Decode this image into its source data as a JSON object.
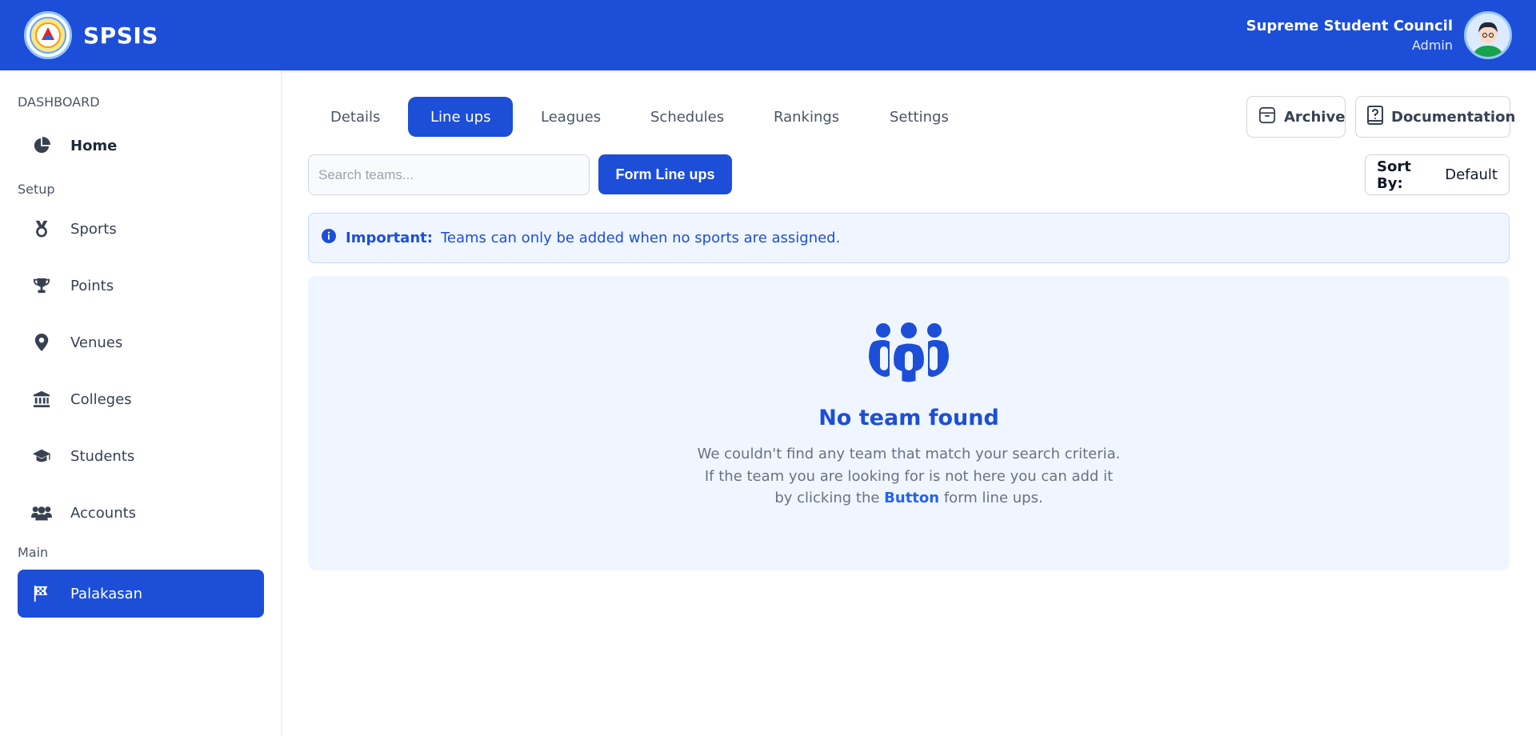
{
  "header": {
    "app_name": "SPSIS",
    "user_name": "Supreme Student Council",
    "user_role": "Admin"
  },
  "sidebar": {
    "dashboard_label": "DASHBOARD",
    "home_label": "Home",
    "setup_label": "Setup",
    "setup_items": [
      {
        "label": "Sports",
        "icon": "medal-icon"
      },
      {
        "label": "Points",
        "icon": "trophy-icon"
      },
      {
        "label": "Venues",
        "icon": "map-pin-icon"
      },
      {
        "label": "Colleges",
        "icon": "building-columns-icon"
      },
      {
        "label": "Students",
        "icon": "graduation-cap-icon"
      },
      {
        "label": "Accounts",
        "icon": "users-icon"
      }
    ],
    "main_label": "Main",
    "main_items": [
      {
        "label": "Palakasan",
        "icon": "checkered-flag-icon",
        "active": true
      }
    ]
  },
  "tabs": [
    {
      "label": "Details"
    },
    {
      "label": "Line ups",
      "active": true
    },
    {
      "label": "Leagues"
    },
    {
      "label": "Schedules"
    },
    {
      "label": "Rankings"
    },
    {
      "label": "Settings"
    }
  ],
  "actions": {
    "archive_label": "Archive",
    "documentation_label": "Documentation"
  },
  "toolbar": {
    "search_placeholder": "Search teams...",
    "form_button_label": "Form Line ups",
    "sort_label": "Sort By:",
    "sort_value": "Default"
  },
  "alert": {
    "title": "Important:",
    "message": "Teams can only be added when no sports are assigned."
  },
  "empty_state": {
    "title": "No team found",
    "line1": "We couldn't find any team that match your search criteria.",
    "line2": "If the team you are looking for is not here you can add it",
    "line3_pre": "by clicking the",
    "line3_highlight": "Button",
    "line3_post": "form line ups."
  },
  "colors": {
    "primary": "#1d4ed8",
    "alert_bg": "#eff6ff",
    "alert_border": "#bfdbfe"
  }
}
